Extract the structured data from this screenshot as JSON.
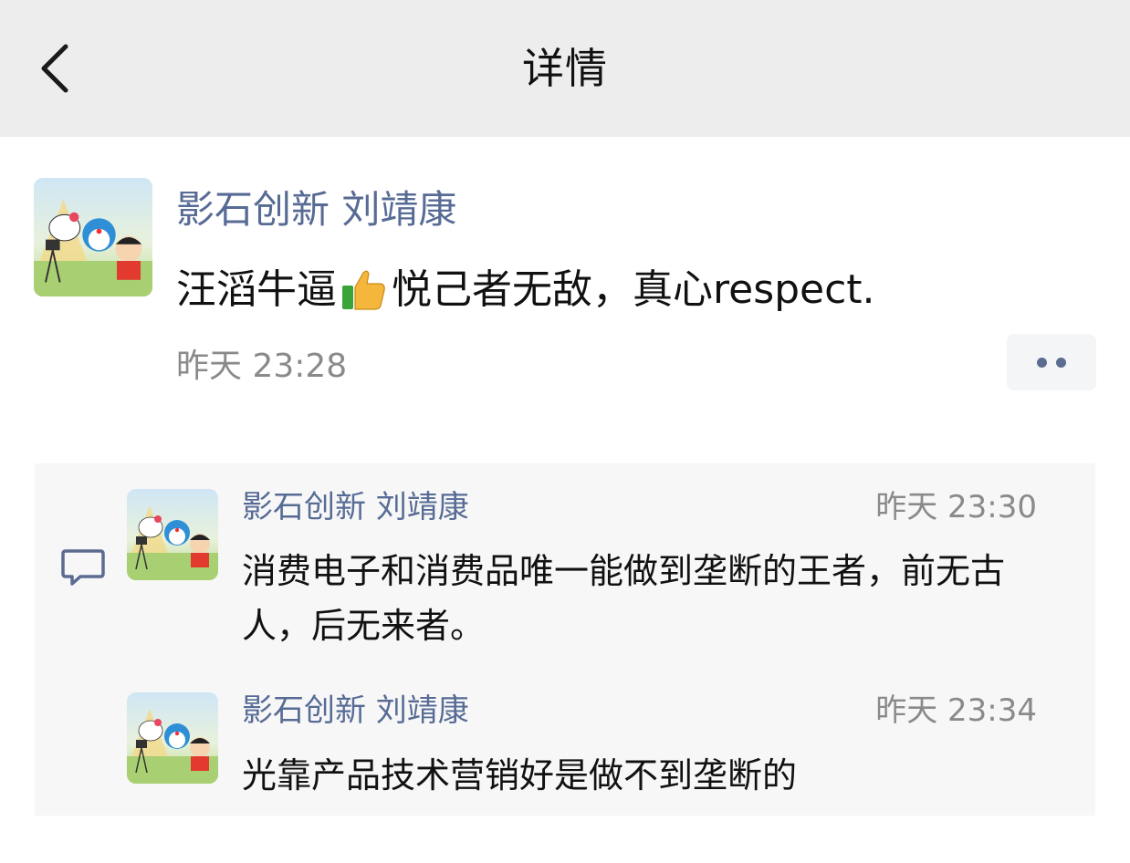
{
  "header": {
    "title": "详情"
  },
  "post": {
    "author": "影石创新 刘靖康",
    "text_before": "汪滔牛逼",
    "text_after": " 悦己者无敌，真心respect.",
    "time": "昨天 23:28"
  },
  "comments": [
    {
      "author": "影石创新 刘靖康",
      "time": "昨天 23:30",
      "text": "消费电子和消费品唯一能做到垄断的王者，前无古人，后无来者。"
    },
    {
      "author": "影石创新 刘靖康",
      "time": "昨天 23:34",
      "text": "光靠产品技术营销好是做不到垄断的"
    }
  ],
  "icons": {
    "back": "chevron-left-icon",
    "thumb": "thumbs-up-icon",
    "more": "more-dots-icon",
    "comment": "comment-bubble-icon"
  },
  "colors": {
    "name_link": "#576b95",
    "header_bg": "#ededed",
    "panel_bg": "#f7f7f7",
    "meta_gray": "#8a8a8a"
  }
}
